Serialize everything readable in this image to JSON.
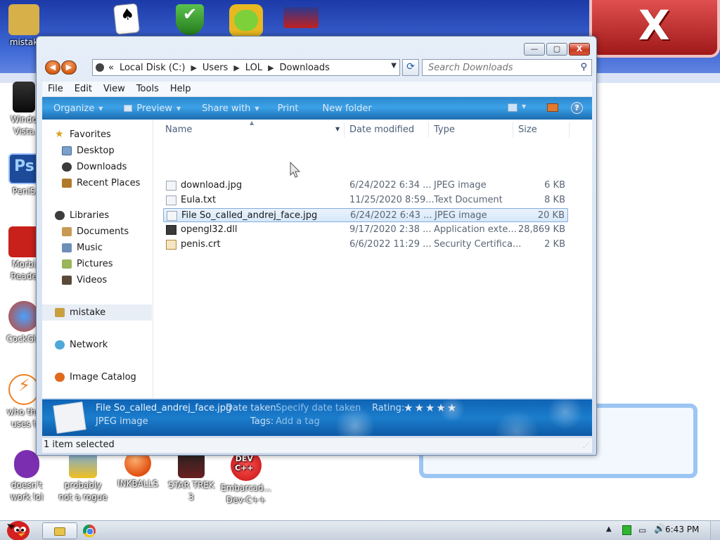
{
  "desktop": {
    "icons": [
      {
        "label": "mistak",
        "color": "#c8a040"
      },
      {
        "label": "Windo\nVista",
        "color": "#1a1a1a"
      },
      {
        "label": "PeniS",
        "color": "#1e4a9a"
      },
      {
        "label": "Morbi\nReade",
        "color": "#c8201a"
      },
      {
        "label": "CockGle",
        "color": "#d04020"
      },
      {
        "label": "who the\nuses t",
        "color": "#f08020"
      },
      {
        "label": "doesn't\nwork lol",
        "color": "#7b2fb0"
      },
      {
        "label": "probably\nnot a rogue",
        "color": "#f0c020"
      },
      {
        "label": "INKBALLS",
        "color": "#e05010"
      },
      {
        "label": "STAR TREK\n3",
        "color": "#6a2020"
      },
      {
        "label": "Embarcad...\nDev-C++",
        "color": "#d01818"
      }
    ],
    "top_icons": [
      {
        "name": "solitaire",
        "color": "#ffffff"
      },
      {
        "name": "security-shield",
        "color": "#34a02c"
      },
      {
        "name": "angry-birds-pig",
        "color": "#e0b020"
      },
      {
        "name": "game-logo",
        "color": "#c02020"
      }
    ]
  },
  "window": {
    "controls": {
      "minimize": "—",
      "maximize": "▢",
      "close": "X"
    },
    "nav": {
      "back": "◀",
      "forward": "▶"
    },
    "breadcrumb": {
      "prefix": "«",
      "items": [
        "Local Disk (C:)",
        "Users",
        "LOL",
        "Downloads"
      ],
      "separator": "▶"
    },
    "search": {
      "placeholder": "Search Downloads"
    },
    "menu": [
      "File",
      "Edit",
      "View",
      "Tools",
      "Help"
    ],
    "commands": {
      "organize": "Organize",
      "preview": "Preview",
      "share_with": "Share with",
      "print": "Print",
      "new_folder": "New folder"
    },
    "navpane": {
      "favorites": "Favorites",
      "desktop": "Desktop",
      "downloads": "Downloads",
      "recent_places": "Recent Places",
      "libraries": "Libraries",
      "documents": "Documents",
      "music": "Music",
      "pictures": "Pictures",
      "videos": "Videos",
      "mistake": "mistake",
      "network": "Network",
      "image_catalog": "Image Catalog"
    },
    "columns": {
      "name": "Name",
      "date_modified": "Date modified",
      "type": "Type",
      "size": "Size"
    },
    "files": [
      {
        "name": "download.jpg",
        "date": "6/24/2022 6:34 ...",
        "type": "JPEG image",
        "size": "6 KB",
        "selected": false,
        "icon": "image-file"
      },
      {
        "name": "Eula.txt",
        "date": "11/25/2020 8:59...",
        "type": "Text Document",
        "size": "8 KB",
        "selected": false,
        "icon": "text-file"
      },
      {
        "name": "File So_called_andrej_face.jpg",
        "date": "6/24/2022 6:43 ...",
        "type": "JPEG image",
        "size": "20 KB",
        "selected": true,
        "icon": "image-file"
      },
      {
        "name": "opengl32.dll",
        "date": "9/17/2020 2:38 ...",
        "type": "Application exte...",
        "size": "28,869 KB",
        "selected": false,
        "icon": "dll-file"
      },
      {
        "name": "penis.crt",
        "date": "6/6/2022 11:29 ...",
        "type": "Security Certifica...",
        "size": "2 KB",
        "selected": false,
        "icon": "certificate-file"
      }
    ],
    "details": {
      "name": "File So_called_andrej_face.jpg",
      "kind": "JPEG image",
      "date_label": "Date taken:",
      "date_value": "Specify date taken",
      "tags_label": "Tags:",
      "tags_value": "Add a tag",
      "rating_label": "Rating:",
      "rating_stars": 5,
      "rating_value": 0
    },
    "status": "1 item selected"
  },
  "taskbar": {
    "clock": "6:43 PM"
  }
}
